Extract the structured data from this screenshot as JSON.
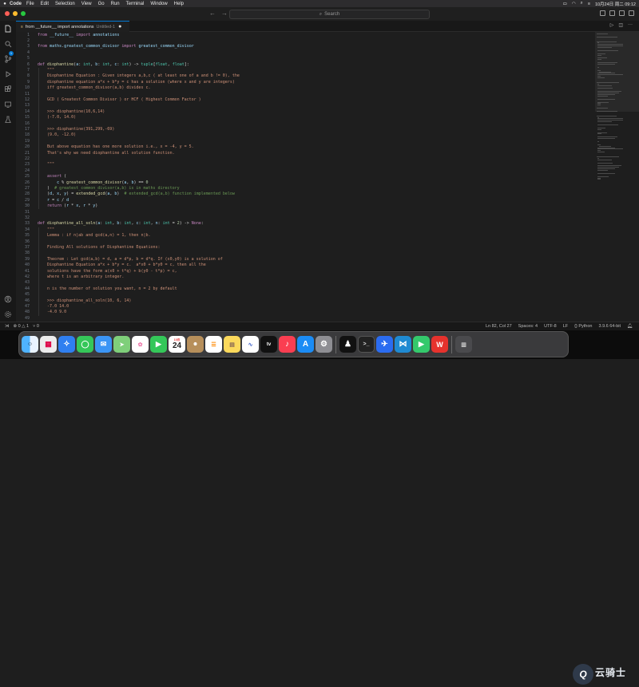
{
  "menubar": {
    "app_name": "Code",
    "items": [
      "File",
      "Edit",
      "Selection",
      "View",
      "Go",
      "Run",
      "Terminal",
      "Window",
      "Help"
    ],
    "clock": "10月24日 周二 09:12"
  },
  "titlebar": {
    "search_placeholder": "Search"
  },
  "activity_bar": {
    "icons": [
      "files-icon",
      "search-icon",
      "source-control-icon",
      "run-debug-icon",
      "extensions-icon",
      "remote-icon",
      "testing-icon"
    ],
    "badge": "1",
    "bottom_icons": [
      "account-icon",
      "settings-gear-icon"
    ]
  },
  "tab": {
    "title": "from __future__ import annotations",
    "subtitle": "Untitled-1",
    "dirty_marker": "●"
  },
  "editor": {
    "lines": [
      {
        "n": "1",
        "text": "from __future__ import annotations"
      },
      {
        "n": "2",
        "text": ""
      },
      {
        "n": "3",
        "text": "from maths.greatest_common_divisor import greatest_common_divisor"
      },
      {
        "n": "4",
        "text": ""
      },
      {
        "n": "5",
        "text": ""
      },
      {
        "n": "6",
        "text": "def diophantine(a: int, b: int, c: int) -> tuple[float, float]:"
      },
      {
        "n": "7",
        "text": "    \"\"\""
      },
      {
        "n": "8",
        "text": "    Diophantine Equation : Given integers a,b,c ( at least one of a and b != 0), the"
      },
      {
        "n": "9",
        "text": "    diophantine equation a*x + b*y = c has a solution (where x and y are integers)"
      },
      {
        "n": "10",
        "text": "    iff greatest_common_divisor(a,b) divides c."
      },
      {
        "n": "11",
        "text": ""
      },
      {
        "n": "12",
        "text": "    GCD ( Greatest Common Divisor ) or HCF ( Highest Common Factor )"
      },
      {
        "n": "13",
        "text": ""
      },
      {
        "n": "14",
        "text": "    >>> diophantine(10,6,14)"
      },
      {
        "n": "15",
        "text": "    (-7.0, 14.0)"
      },
      {
        "n": "16",
        "text": ""
      },
      {
        "n": "17",
        "text": "    >>> diophantine(391,299,-69)"
      },
      {
        "n": "18",
        "text": "    (9.0, -12.0)"
      },
      {
        "n": "19",
        "text": ""
      },
      {
        "n": "20",
        "text": "    But above equation has one more solution i.e., x = -4, y = 5."
      },
      {
        "n": "21",
        "text": "    That's why we need diophantine all solution function."
      },
      {
        "n": "22",
        "text": ""
      },
      {
        "n": "23",
        "text": "    \"\"\""
      },
      {
        "n": "24",
        "text": ""
      },
      {
        "n": "25",
        "text": "    assert ("
      },
      {
        "n": "26",
        "text": "        c % greatest_common_divisor(a, b) == 0"
      },
      {
        "n": "27",
        "text": "    )  # greatest_common_divisor(a,b) is in maths directory"
      },
      {
        "n": "28",
        "text": "    (d, x, y) = extended_gcd(a, b)  # extended_gcd(a,b) function implemented below"
      },
      {
        "n": "29",
        "text": "    r = c / d"
      },
      {
        "n": "30",
        "text": "    return (r * x, r * y)"
      },
      {
        "n": "31",
        "text": ""
      },
      {
        "n": "32",
        "text": ""
      },
      {
        "n": "33",
        "text": "def diophantine_all_soln(a: int, b: int, c: int, n: int = 2) -> None:"
      },
      {
        "n": "34",
        "text": "    \"\"\""
      },
      {
        "n": "35",
        "text": "    Lemma : if n|ab and gcd(a,n) = 1, then n|b."
      },
      {
        "n": "36",
        "text": ""
      },
      {
        "n": "37",
        "text": "    Finding All solutions of Diophantine Equations:"
      },
      {
        "n": "38",
        "text": ""
      },
      {
        "n": "39",
        "text": "    Theorem : Let gcd(a,b) = d, a = d*p, b = d*q. If (x0,y0) is a solution of"
      },
      {
        "n": "40",
        "text": "    Diophantine Equation a*x + b*y = c.  a*x0 + b*y0 = c, then all the"
      },
      {
        "n": "41",
        "text": "    solutions have the form a(x0 + t*q) + b(y0 - t*p) = c,"
      },
      {
        "n": "42",
        "text": "    where t is an arbitrary integer."
      },
      {
        "n": "43",
        "text": ""
      },
      {
        "n": "44",
        "text": "    n is the number of solution you want, n = 2 by default"
      },
      {
        "n": "45",
        "text": ""
      },
      {
        "n": "46",
        "text": "    >>> diophantine_all_soln(10, 6, 14)"
      },
      {
        "n": "47",
        "text": "    -7.0 14.0"
      },
      {
        "n": "48",
        "text": "    -4.0 9.0"
      },
      {
        "n": "49",
        "text": ""
      }
    ]
  },
  "statusbar": {
    "errors": "0",
    "warnings": "1",
    "ports": "0",
    "position": "Ln 82, Col 27",
    "spaces": "Spaces: 4",
    "encoding": "UTF-8",
    "eol": "LF",
    "language": "Python",
    "interpreter": "3.9.6 64-bit"
  },
  "dock": {
    "calendar_month": "10月",
    "calendar_day": "24",
    "apps": [
      "finder-icon",
      "launchpad-icon",
      "safari-icon",
      "messages-icon",
      "mail-icon",
      "maps-icon",
      "photos-icon",
      "facetime-icon",
      "calendar-icon",
      "contacts-icon",
      "reminders-icon",
      "notes-icon",
      "freeform-icon",
      "appletv-icon",
      "music-icon",
      "appstore-icon",
      "system-settings-icon",
      "qq-icon",
      "terminal-icon",
      "feishu-icon",
      "vscode-icon",
      "player-icon",
      "wps-icon",
      "trash-icon"
    ]
  },
  "watermark": {
    "glyph": "Q",
    "text": "云骑士"
  },
  "colors": {
    "keyword": "#c586c0",
    "function": "#dcdcaa",
    "type": "#4ec9b0",
    "string": "#ce9178",
    "comment": "#6a9955",
    "number": "#b5cea8",
    "accent": "#0078d4"
  }
}
